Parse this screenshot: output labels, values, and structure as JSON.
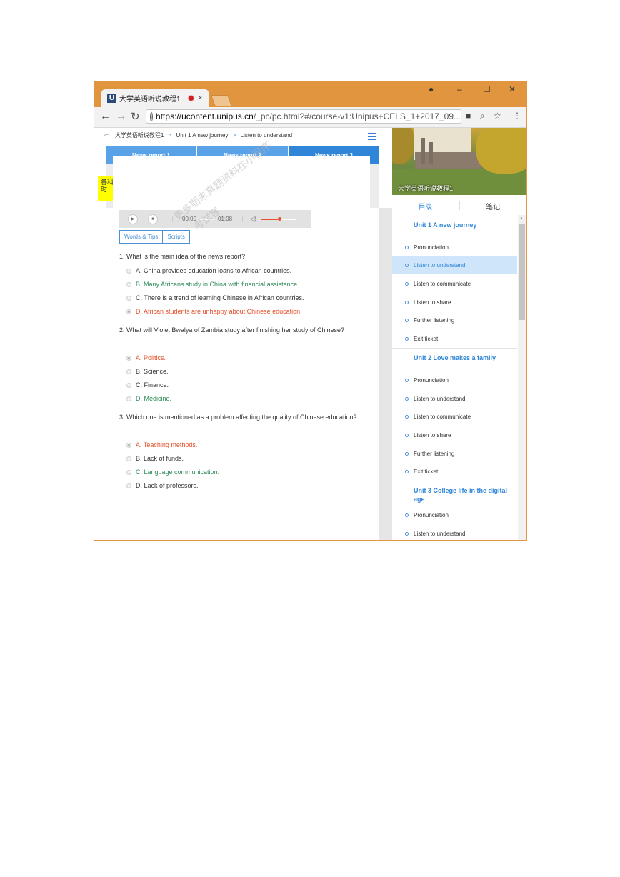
{
  "browser": {
    "tab_title": "大学英语听说教程1",
    "tab_close": "×",
    "url_host": "https://ucontent.unipus.cn",
    "url_path": "/_pc/pc.html?#/course-v1:Unipus+CELS_1+2017_09...",
    "controls": {
      "minimize": "–",
      "maximize": "☐",
      "close": "✕"
    }
  },
  "breadcrumb": {
    "course": "大学英语听说教程1",
    "unit": "Unit 1 A new journey",
    "section": "Listen to understand"
  },
  "report_tabs": [
    "News report 1",
    "News report 2",
    "News report 3"
  ],
  "yellow_left_text": "各科\n时...",
  "player": {
    "current_time": "00:00",
    "total_time": "01:08",
    "progress": 0,
    "volume": 0.5
  },
  "buttons": {
    "words_tips": "Words & Tips",
    "scripts": "Scripts"
  },
  "questions": [
    {
      "text": "1. What is the main idea of the news report?",
      "options": [
        {
          "text": "A. China provides education loans to African countries.",
          "state": "normal"
        },
        {
          "text": "B. Many Africans study in China with financial assistance.",
          "state": "correct"
        },
        {
          "text": "C. There is a trend of learning Chinese in African countries.",
          "state": "normal"
        },
        {
          "text": "D. African students are unhappy about Chinese education.",
          "state": "wrong"
        }
      ]
    },
    {
      "text": "2. What will Violet Bwalya of Zambia study after finishing her study of Chinese?",
      "options": [
        {
          "text": "A. Politics.",
          "state": "wrong"
        },
        {
          "text": "B. Science.",
          "state": "normal"
        },
        {
          "text": "C. Finance.",
          "state": "normal"
        },
        {
          "text": "D. Medicine.",
          "state": "correct"
        }
      ]
    },
    {
      "text": "3. Which one is mentioned as a problem affecting the quality of Chinese education?",
      "options": [
        {
          "text": "A. Teaching methods.",
          "state": "wrong"
        },
        {
          "text": "B. Lack of funds.",
          "state": "normal"
        },
        {
          "text": "C. Language communication.",
          "state": "correct"
        },
        {
          "text": "D. Lack of professors.",
          "state": "normal"
        }
      ]
    }
  ],
  "watermark": "更多期末真题资料在小程序",
  "watermark2": "考试客",
  "sidebar": {
    "banner_title": "大学英语听说教程1",
    "tabs": [
      "目录",
      "笔记"
    ],
    "units": [
      {
        "title": "Unit 1 A new journey",
        "items": [
          "Pronunciation",
          "Listen to understand",
          "Listen to communicate",
          "Listen to share",
          "Further listening",
          "Exit ticket"
        ]
      },
      {
        "title": "Unit 2 Love makes a family",
        "items": [
          "Pronunciation",
          "Listen to understand",
          "Listen to communicate",
          "Listen to share",
          "Further listening",
          "Exit ticket"
        ]
      },
      {
        "title": "Unit 3 College life in the digital age",
        "items": [
          "Pronunciation",
          "Listen to understand"
        ]
      }
    ],
    "active_item": "Listen to understand"
  },
  "colors": {
    "titlebar": "#e0953e",
    "accent": "#2f86d8",
    "correct": "#2e8b57",
    "wrong": "#e6502a",
    "highlight": "#ffff00"
  }
}
